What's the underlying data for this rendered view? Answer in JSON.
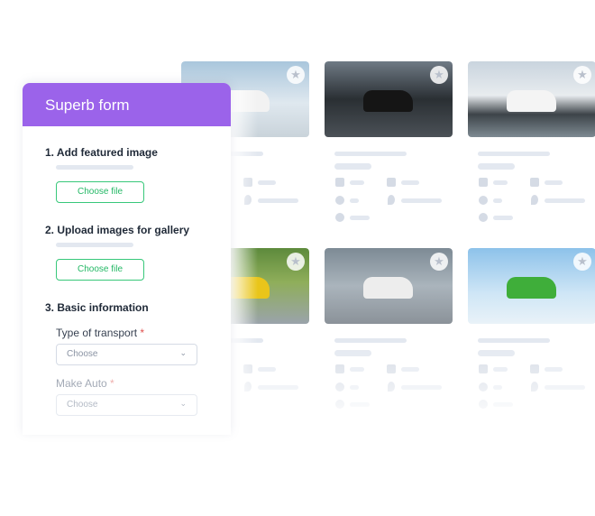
{
  "form": {
    "title": "Superb form",
    "section1": "1. Add featured image",
    "choose1": "Choose file",
    "section2": "2. Upload images for gallery",
    "choose2": "Choose file",
    "section3": "3. Basic information",
    "transport_label": "Type of transport",
    "required_mark": "*",
    "transport_value": "Choose",
    "make_label": "Make Auto",
    "make_value": "Choose"
  },
  "colors": {
    "header": "#9b63ea",
    "button": "#24b865",
    "required": "#e0524f"
  },
  "cards": [
    {
      "image": "white off-road SUV in snowy landscape",
      "icon": "star-icon"
    },
    {
      "image": "black sports car on road",
      "icon": "star-icon"
    },
    {
      "image": "white SUV near snowy mountains",
      "icon": "star-icon"
    },
    {
      "image": "yellow supercar",
      "icon": "star-icon"
    },
    {
      "image": "white sports car by building",
      "icon": "star-icon"
    },
    {
      "image": "green lifted pickup truck",
      "icon": "star-icon"
    }
  ]
}
